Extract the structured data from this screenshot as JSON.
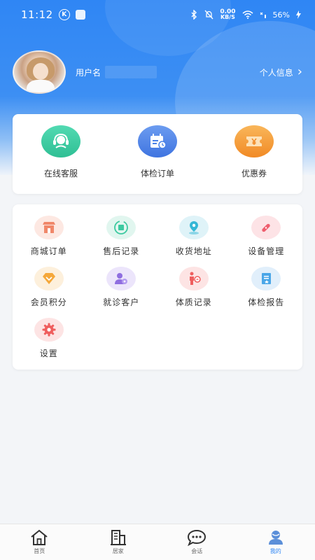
{
  "status_bar": {
    "time": "11:12",
    "k_badge": "K",
    "net_speed_value": "0.00",
    "net_speed_unit": "KB/S",
    "battery": "56%"
  },
  "user": {
    "username_label": "用户名",
    "profile_link": "个人信息"
  },
  "top_actions": [
    {
      "label": "在线客服",
      "icon": "headset-icon",
      "color": "#3cc9a0"
    },
    {
      "label": "体检订单",
      "icon": "calendar-icon",
      "color": "#4a82e8"
    },
    {
      "label": "优惠券",
      "icon": "coupon-icon",
      "color": "#f59d3a"
    }
  ],
  "grid_items": [
    {
      "label": "商城订单",
      "icon": "shop-icon",
      "color": "#f0876a"
    },
    {
      "label": "售后记录",
      "icon": "after-sales-icon",
      "color": "#3cc9a0"
    },
    {
      "label": "收货地址",
      "icon": "location-icon",
      "color": "#35b7d6"
    },
    {
      "label": "设备管理",
      "icon": "device-icon",
      "color": "#ef5e6e"
    },
    {
      "label": "会员积分",
      "icon": "points-icon",
      "color": "#f5a83a"
    },
    {
      "label": "就诊客户",
      "icon": "patient-icon",
      "color": "#8f6ee0"
    },
    {
      "label": "体质记录",
      "icon": "constitution-icon",
      "color": "#ef5e5e"
    },
    {
      "label": "体检报告",
      "icon": "report-icon",
      "color": "#4aa6e8"
    },
    {
      "label": "设置",
      "icon": "settings-icon",
      "color": "#ef5e5e"
    }
  ],
  "bottom_nav": [
    {
      "label": "首页",
      "icon": "home-icon"
    },
    {
      "label": "居家",
      "icon": "building-icon"
    },
    {
      "label": "会话",
      "icon": "chat-icon"
    },
    {
      "label": "我的",
      "icon": "profile-icon",
      "active": true
    }
  ]
}
